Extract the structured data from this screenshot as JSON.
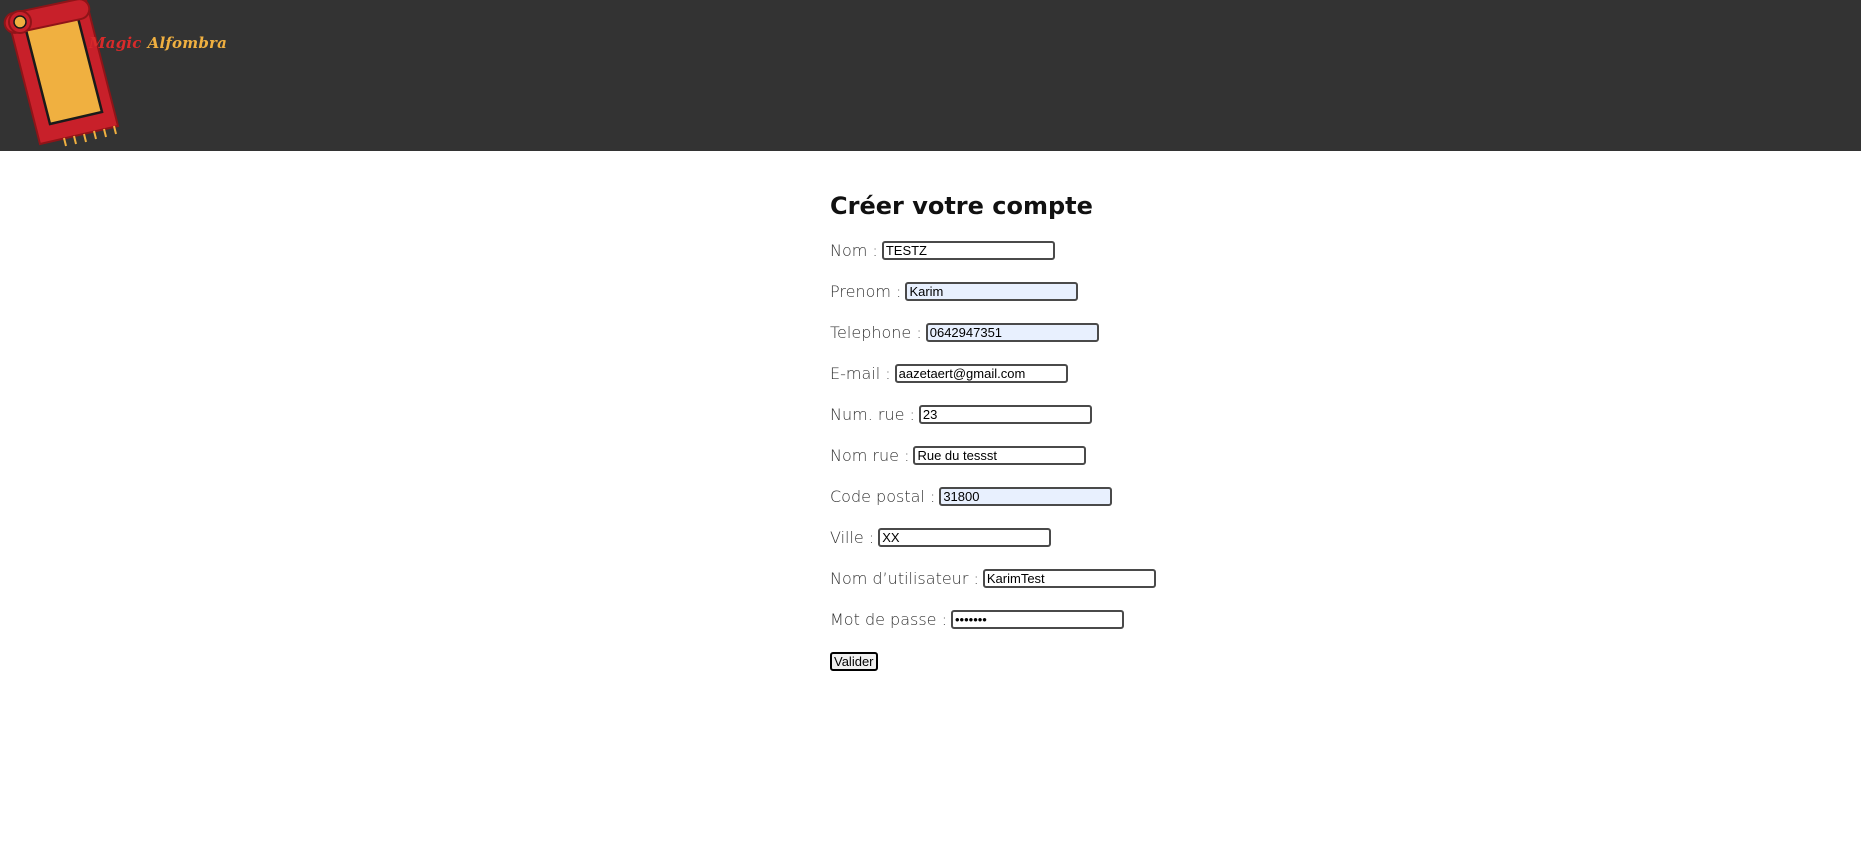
{
  "brand": {
    "word1": "Magic",
    "word2": "Alfombra"
  },
  "form": {
    "title": "Créer votre compte",
    "fields": {
      "nom": {
        "label": "Nom :",
        "value": "TESTZ"
      },
      "prenom": {
        "label": "Prenom :",
        "value": "Karim"
      },
      "telephone": {
        "label": "Telephone :",
        "value": "0642947351"
      },
      "email": {
        "label": "E-mail :",
        "value": "aazetaert@gmail.com"
      },
      "num_rue": {
        "label": "Num. rue :",
        "value": "23"
      },
      "nom_rue": {
        "label": "Nom rue :",
        "value": "Rue du tessst"
      },
      "code_postal": {
        "label": "Code postal :",
        "value": "31800"
      },
      "ville": {
        "label": "Ville :",
        "value": "XX"
      },
      "username": {
        "label": "Nom d’utilisateur :",
        "value": "KarimTest"
      },
      "password": {
        "label": "Mot de passe :",
        "value": "•••••••"
      }
    },
    "submit_label": "Valider"
  },
  "colors": {
    "header_bg": "#333333",
    "logo_red": "#c8202a",
    "logo_gold": "#f0b040"
  }
}
